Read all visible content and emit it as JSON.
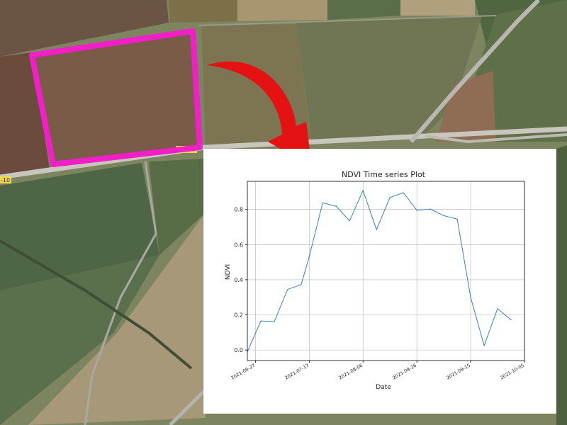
{
  "map": {
    "road_labels": [
      "-10",
      "-10"
    ],
    "colors": {
      "highlight_outline": "#f21ec8",
      "arrow": "#e41212",
      "road": "#c9c6bd",
      "road_marker": "#f5d84a"
    }
  },
  "chart_data": {
    "type": "line",
    "title": "NDVI Time series Plot",
    "xlabel": "Date",
    "ylabel": "NDVI",
    "x_tick_labels": [
      "2021-06-27",
      "2021-07-17",
      "2021-08-06",
      "2021-08-26",
      "2021-09-15",
      "2021-10-05"
    ],
    "y_tick_labels": [
      "0.0",
      "0.2",
      "0.4",
      "0.6",
      "0.8"
    ],
    "ylim": [
      -0.06,
      0.96
    ],
    "xlim": [
      "2021-06-24",
      "2021-10-05"
    ],
    "grid": true,
    "series": [
      {
        "color": "#1f77b4",
        "points": [
          {
            "date": "2021-06-24",
            "value": -0.01
          },
          {
            "date": "2021-06-29",
            "value": 0.165
          },
          {
            "date": "2021-07-04",
            "value": 0.162
          },
          {
            "date": "2021-07-09",
            "value": 0.345
          },
          {
            "date": "2021-07-14",
            "value": 0.372
          },
          {
            "date": "2021-07-17",
            "value": 0.532
          },
          {
            "date": "2021-07-22",
            "value": 0.838
          },
          {
            "date": "2021-07-27",
            "value": 0.818
          },
          {
            "date": "2021-08-01",
            "value": 0.735
          },
          {
            "date": "2021-08-06",
            "value": 0.908
          },
          {
            "date": "2021-08-11",
            "value": 0.685
          },
          {
            "date": "2021-08-16",
            "value": 0.868
          },
          {
            "date": "2021-08-21",
            "value": 0.895
          },
          {
            "date": "2021-08-26",
            "value": 0.795
          },
          {
            "date": "2021-08-31",
            "value": 0.802
          },
          {
            "date": "2021-09-05",
            "value": 0.765
          },
          {
            "date": "2021-09-10",
            "value": 0.745
          },
          {
            "date": "2021-09-15",
            "value": 0.298
          },
          {
            "date": "2021-09-20",
            "value": 0.025
          },
          {
            "date": "2021-09-25",
            "value": 0.235
          },
          {
            "date": "2021-09-30",
            "value": 0.172
          }
        ]
      }
    ]
  }
}
